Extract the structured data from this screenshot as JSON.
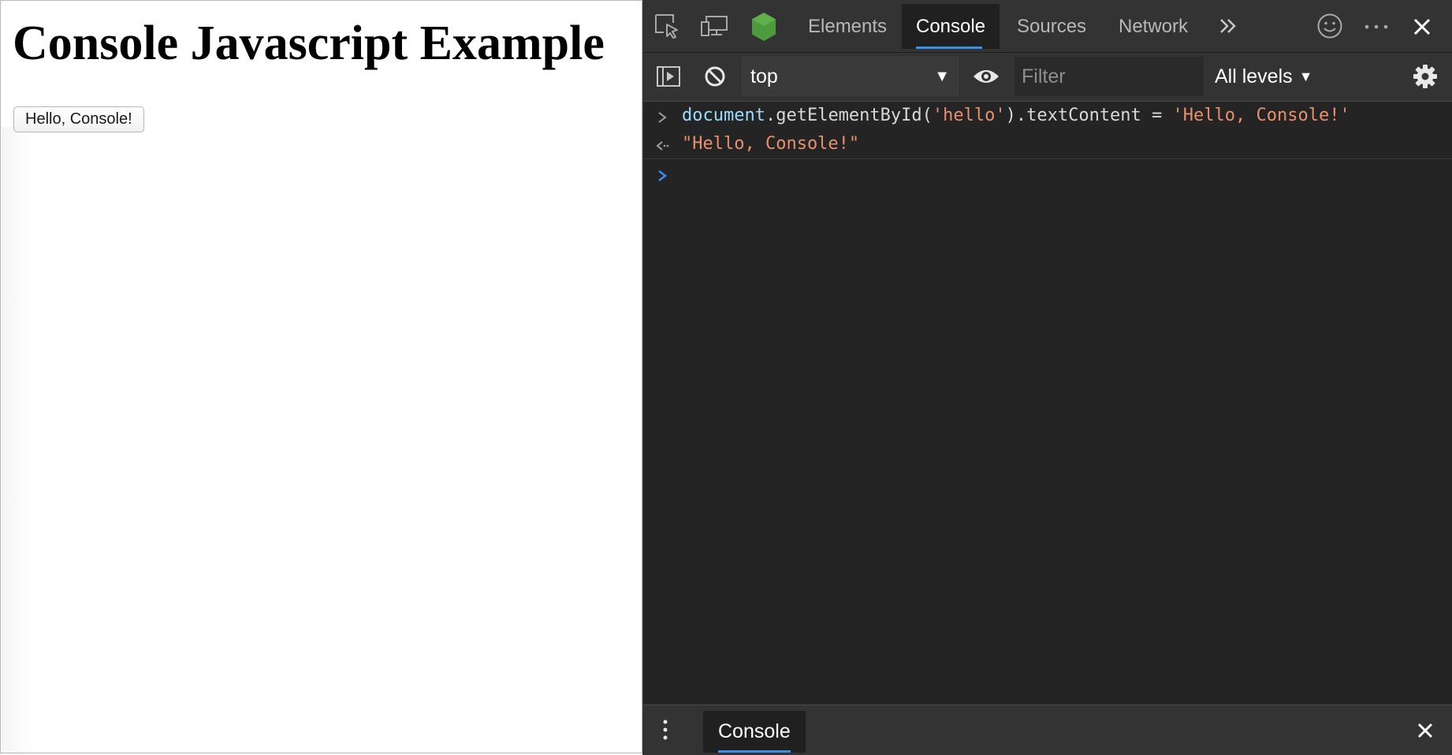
{
  "page": {
    "heading": "Console Javascript Example",
    "button_label": "Hello, Console!"
  },
  "devtools": {
    "tabs": [
      {
        "label": "Elements",
        "active": false
      },
      {
        "label": "Console",
        "active": true
      },
      {
        "label": "Sources",
        "active": false
      },
      {
        "label": "Network",
        "active": false
      }
    ],
    "toolbar": {
      "context": "top",
      "filter_placeholder": "Filter",
      "filter_value": "",
      "levels_label": "All levels"
    },
    "console": {
      "input_line": {
        "object": "document",
        "method": ".getElementById(",
        "arg": "'hello'",
        "rest": ").textContent = ",
        "assigned": "'Hello, Console!'"
      },
      "output_line": "\"Hello, Console!\""
    },
    "drawer": {
      "tab_label": "Console"
    },
    "icons": [
      "inspect-icon",
      "device-emulation-icon",
      "node-icon",
      "more-tabs-icon",
      "feedback-icon",
      "more-options-icon",
      "close-icon",
      "sidebar-toggle-icon",
      "clear-console-icon",
      "live-expression-icon",
      "settings-icon",
      "drawer-menu-icon",
      "drawer-close-icon"
    ],
    "colors": {
      "accent": "#3b8fe8",
      "panel_bg": "#242424",
      "toolbar_bg": "#333333",
      "string": "#e6906e",
      "object": "#9bdcfe",
      "node_green": "#4e9a3e"
    }
  }
}
